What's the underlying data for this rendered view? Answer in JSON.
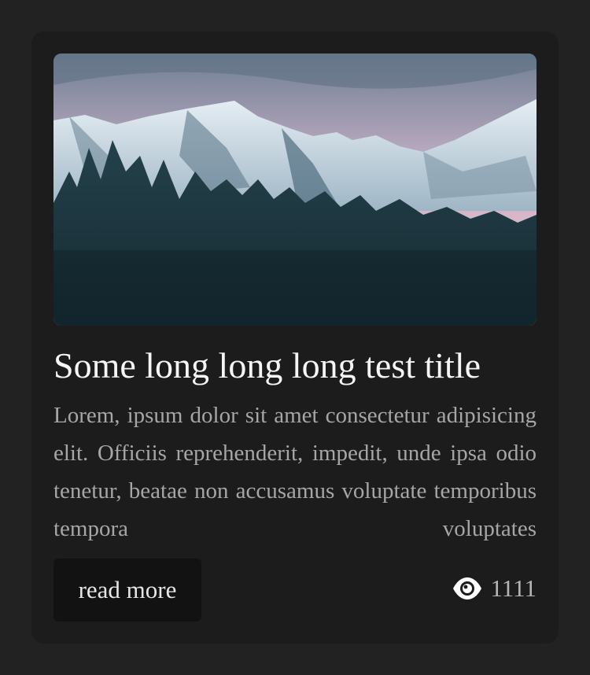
{
  "card": {
    "image_alt": "snowy mountains behind a dark pine forest",
    "title": "Some long long long test title",
    "excerpt": "Lorem, ipsum dolor sit amet consectetur adipisicing elit. Officiis reprehenderit, impedit, unde ipsa odio tenetur, beatae non accusamus voluptate temporibus tempora voluptates",
    "read_more_label": "read more",
    "views_count": "1111",
    "views_icon": "eye-icon"
  },
  "colors": {
    "page_background": "#222222",
    "card_background": "#1c1c1c",
    "button_background": "#121212",
    "title_color": "#f5f5f5",
    "excerpt_color": "#a6a6a6"
  }
}
